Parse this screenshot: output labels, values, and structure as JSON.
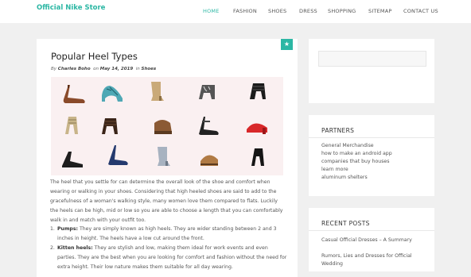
{
  "site": {
    "title": "Official Nike Store"
  },
  "nav": {
    "items": [
      "HOME",
      "FASHION",
      "SHOES",
      "DRESS",
      "SHOPPING",
      "SITEMAP",
      "CONTACT US"
    ],
    "active_index": 0
  },
  "post": {
    "badge_icon": "star-icon",
    "title": "Popular Heel Types",
    "meta": {
      "by": "By",
      "author": "Charles Boho",
      "on": "on",
      "date": "May 14, 2019",
      "in": "in",
      "category": "Shoes"
    },
    "image_alt": "Grid of women's heel shoes",
    "intro": "The heel that you settle for can determine the overall look of the shoe and comfort when wearing or walking in your shoes. Considering that high heeled shoes are said to add to the gracefulness of a woman's walking style, many women love them compared to flats. Luckily the heels can be high, mid or low so you are able to choose a length that you can comfortably walk in and match with your outfit too.",
    "list": [
      {
        "num": "1.",
        "term": "Pumps:",
        "text": " They are simply known as high heels. They are wider standing between 2 and 3 inches in height. The heels have a low cut around the front."
      },
      {
        "num": "2.",
        "term": "Kitten heels:",
        "text": " They are stylish and low, making them ideal for work events and even parties. They are the best when you are looking for comfort and fashion without the need for extra height. Their low nature makes them suitable for all day wearing."
      }
    ]
  },
  "sidebar": {
    "partners": {
      "title": "PARTNERS",
      "links": [
        "General Merchandise",
        "how to make an android app",
        "companies that buy houses",
        "learn more",
        "aluminum shelters"
      ]
    },
    "recent": {
      "title": "RECENT POSTS",
      "links": [
        "Casual Official Dresses – A Summary",
        "Rumors, Lies and Dresses for Official Wedding"
      ]
    }
  },
  "colors": {
    "accent": "#2cb7a4",
    "page_bg": "#f0f0f0",
    "card_bg": "#ffffff"
  }
}
